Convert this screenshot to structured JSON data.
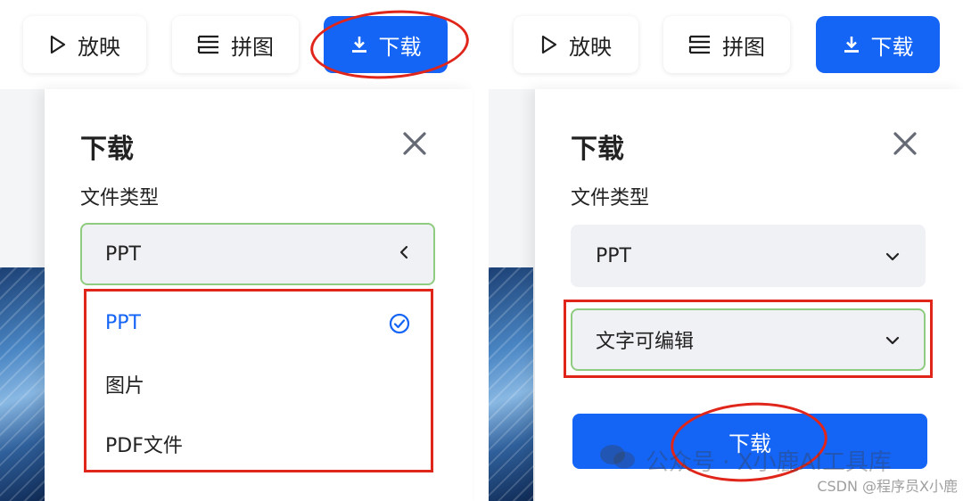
{
  "toolbar": {
    "play_label": "放映",
    "collage_label": "拼图",
    "download_label": "下载"
  },
  "left_panel": {
    "title": "下载",
    "file_type_label": "文件类型",
    "selected_value": "PPT",
    "options": [
      {
        "label": "PPT",
        "selected": true
      },
      {
        "label": "图片",
        "selected": false
      },
      {
        "label": "PDF文件",
        "selected": false
      }
    ]
  },
  "right_panel": {
    "title": "下载",
    "file_type_label": "文件类型",
    "file_type_value": "PPT",
    "mode_value": "文字可编辑",
    "download_button": "下载"
  },
  "watermark": {
    "text": "公众号 · X小鹿AI工具库",
    "csdn": "CSDN @程序员X小鹿"
  },
  "colors": {
    "accent": "#1464f6",
    "annotation_red": "#e0251b",
    "focus_green": "#90cc80"
  }
}
